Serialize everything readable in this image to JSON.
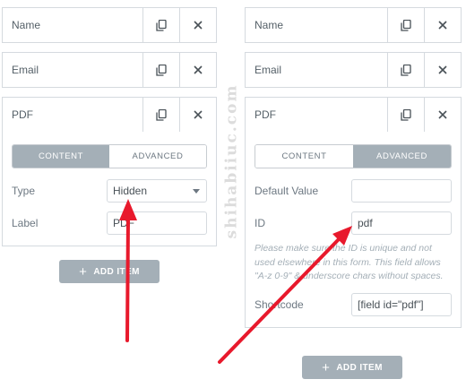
{
  "left": {
    "items": [
      {
        "label": "Name"
      },
      {
        "label": "Email"
      },
      {
        "label": "PDF"
      }
    ],
    "tabs": {
      "content": "CONTENT",
      "advanced": "ADVANCED",
      "active": "content"
    },
    "fields": {
      "type": {
        "label": "Type",
        "value": "Hidden"
      },
      "label": {
        "label": "Label",
        "value": "PDF"
      }
    },
    "add_item": "ADD ITEM"
  },
  "right": {
    "items": [
      {
        "label": "Name"
      },
      {
        "label": "Email"
      },
      {
        "label": "PDF"
      }
    ],
    "tabs": {
      "content": "CONTENT",
      "advanced": "ADVANCED",
      "active": "advanced"
    },
    "fields": {
      "default_value": {
        "label": "Default Value",
        "value": ""
      },
      "id": {
        "label": "ID",
        "value": "pdf"
      },
      "help": "Please make sure the ID is unique and not used elsewhere in this form. This field allows \"A-z 0-9\" & underscore chars without spaces.",
      "shortcode": {
        "label": "Shortcode",
        "value": "[field id=\"pdf\"]"
      }
    },
    "add_item": "ADD ITEM"
  },
  "watermark": "shihabiiuc.com",
  "colors": {
    "border": "#d5dadf",
    "active_tab": "#a4afb7",
    "arrow": "#e8192c",
    "button": "#a4afb7"
  },
  "icons": {
    "duplicate": "copy-icon",
    "remove": "close-icon"
  }
}
